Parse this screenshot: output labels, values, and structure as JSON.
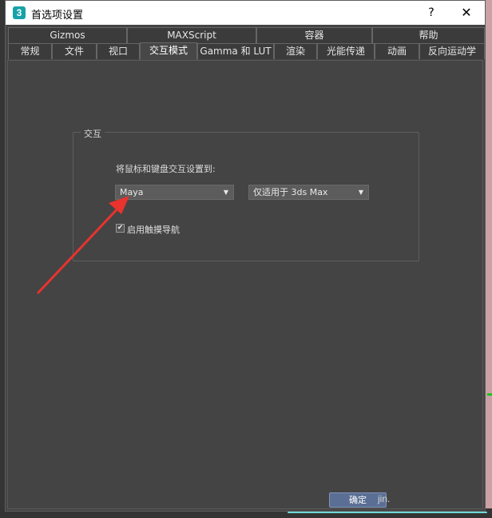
{
  "window": {
    "app_icon_text": "3",
    "title": "首选项设置",
    "help_label": "?",
    "close_label": "✕"
  },
  "tabs_row1": [
    "Gizmos",
    "MAXScript",
    "容器",
    "帮助"
  ],
  "tabs_row2": [
    "常规",
    "文件",
    "视口",
    "交互模式",
    "Gamma 和 LUT",
    "渲染",
    "光能传递",
    "动画",
    "反向运动学"
  ],
  "active_tab": "交互模式",
  "interaction": {
    "group_title": "交互",
    "prompt": "将鼠标和键盘交互设置到:",
    "mode_select": "Maya",
    "scope_select": "仅适用于 3ds Max",
    "touch_nav_label": "启用触摸导航",
    "touch_nav_checked": true
  },
  "footer": {
    "ok_label": "确定",
    "watermark": "jin."
  },
  "colors": {
    "dialog_bg": "#444444",
    "ok_button": "#5a6f93",
    "arrow_annotation": "#e8332e"
  }
}
